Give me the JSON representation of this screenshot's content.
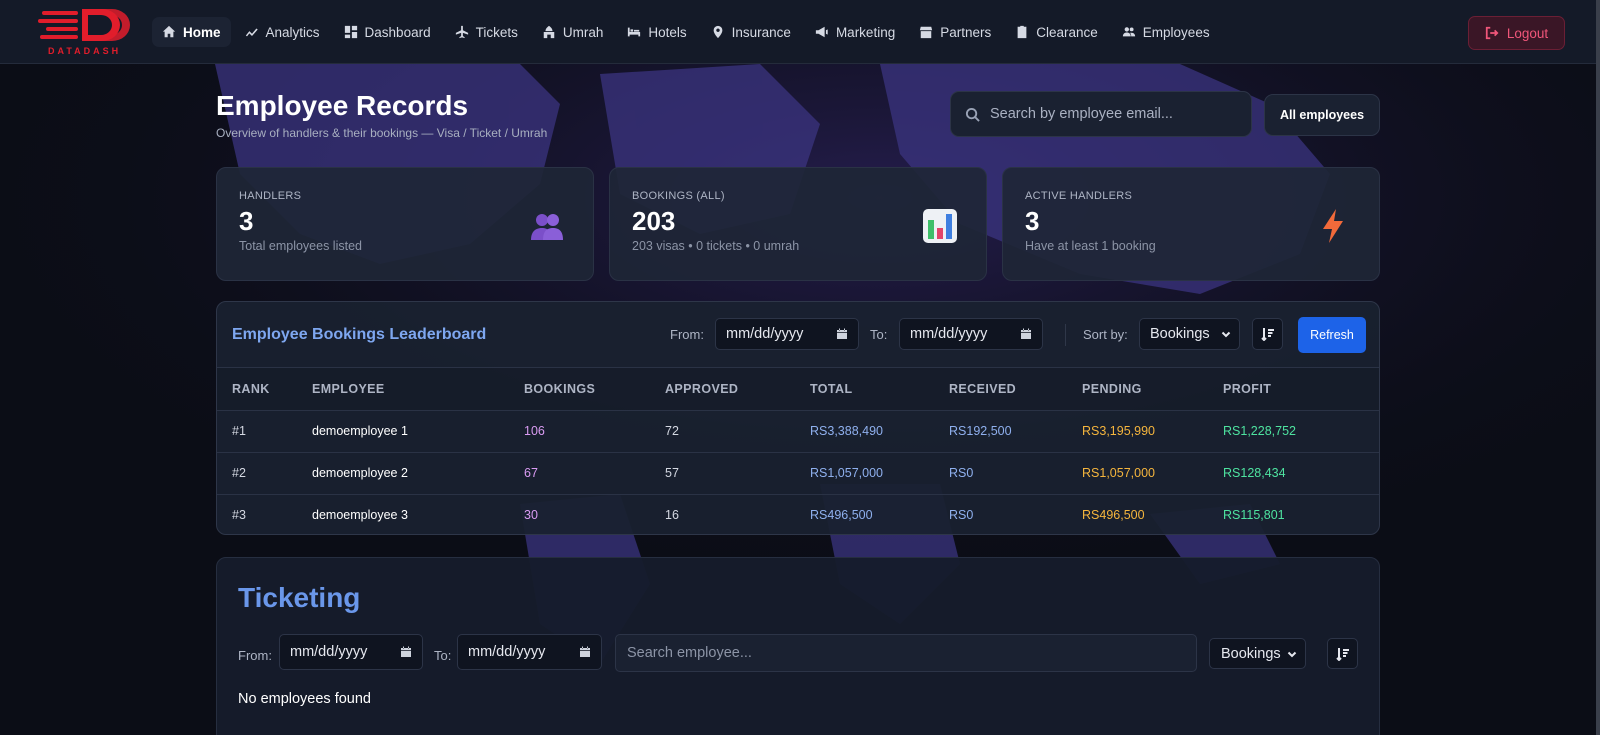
{
  "brand": {
    "logo_text": "DATADASH",
    "accent": "#e11d2b"
  },
  "nav": {
    "items": [
      {
        "label": "Home",
        "icon": "home-icon",
        "active": true
      },
      {
        "label": "Analytics",
        "icon": "trend-icon"
      },
      {
        "label": "Dashboard",
        "icon": "grid-icon"
      },
      {
        "label": "Tickets",
        "icon": "plane-icon"
      },
      {
        "label": "Umrah",
        "icon": "mosque-icon"
      },
      {
        "label": "Hotels",
        "icon": "bed-icon"
      },
      {
        "label": "Insurance",
        "icon": "pin-icon"
      },
      {
        "label": "Marketing",
        "icon": "megaphone-icon"
      },
      {
        "label": "Partners",
        "icon": "store-icon"
      },
      {
        "label": "Clearance",
        "icon": "clipboard-icon"
      },
      {
        "label": "Employees",
        "icon": "users-icon"
      }
    ],
    "logout": "Logout"
  },
  "page": {
    "title": "Employee Records",
    "subtitle": "Overview of handlers & their bookings — Visa / Ticket / Umrah",
    "search_placeholder": "Search by employee email...",
    "all_button": "All employees"
  },
  "stats": [
    {
      "label": "HANDLERS",
      "value": "3",
      "desc": "Total employees listed",
      "icon": "people-icon"
    },
    {
      "label": "BOOKINGS (ALL)",
      "value": "203",
      "desc": "203 visas • 0 tickets • 0 umrah",
      "icon": "bar-chart-icon"
    },
    {
      "label": "ACTIVE HANDLERS",
      "value": "3",
      "desc": "Have at least 1 booking",
      "icon": "lightning-icon"
    }
  ],
  "leaderboard": {
    "title": "Employee Bookings Leaderboard",
    "from_label": "From:",
    "to_label": "To:",
    "date_placeholder": "mm/dd/yyyy",
    "sort_label": "Sort by:",
    "sort_value": "Bookings",
    "refresh": "Refresh",
    "columns": [
      "RANK",
      "EMPLOYEE",
      "BOOKINGS",
      "APPROVED",
      "TOTAL",
      "RECEIVED",
      "PENDING",
      "PROFIT"
    ],
    "rows": [
      {
        "rank": "#1",
        "employee": "demoemployee 1",
        "bookings": "106",
        "approved": "72",
        "total": "RS3,388,490",
        "received": "RS192,500",
        "pending": "RS3,195,990",
        "profit": "RS1,228,752"
      },
      {
        "rank": "#2",
        "employee": "demoemployee 2",
        "bookings": "67",
        "approved": "57",
        "total": "RS1,057,000",
        "received": "RS0",
        "pending": "RS1,057,000",
        "profit": "RS128,434"
      },
      {
        "rank": "#3",
        "employee": "demoemployee 3",
        "bookings": "30",
        "approved": "16",
        "total": "RS496,500",
        "received": "RS0",
        "pending": "RS496,500",
        "profit": "RS115,801"
      }
    ]
  },
  "ticketing": {
    "title": "Ticketing",
    "from_label": "From:",
    "to_label": "To:",
    "date_placeholder": "mm/dd/yyyy",
    "search_placeholder": "Search employee...",
    "sort_value": "Bookings",
    "empty": "No employees found"
  }
}
